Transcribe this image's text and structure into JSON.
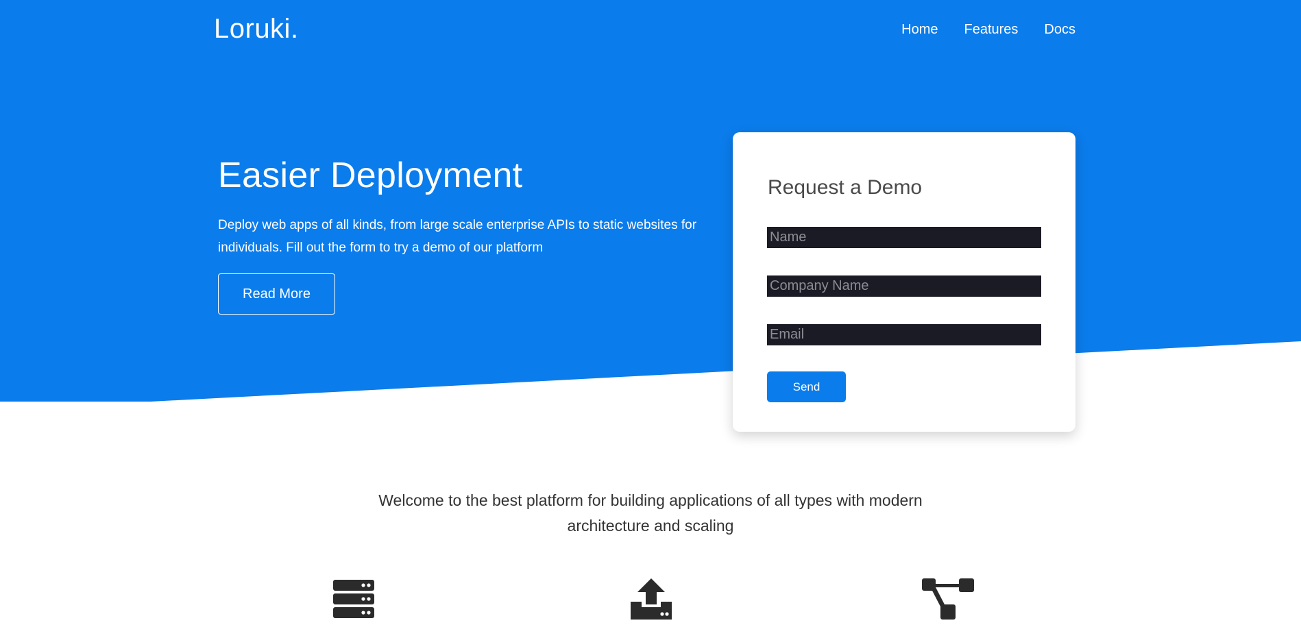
{
  "brand": {
    "logo": "Loruki.",
    "primary_color": "#0b7ceb",
    "input_bg_color": "#1b1b25",
    "text_dark_color": "#333333"
  },
  "nav": {
    "items": [
      {
        "label": "Home"
      },
      {
        "label": "Features"
      },
      {
        "label": "Docs"
      }
    ]
  },
  "hero": {
    "title": "Easier Deployment",
    "text": "Deploy web apps of all kinds, from large scale enterprise APIs to static websites for individuals. Fill out the form to try a demo of our platform",
    "button_label": "Read More"
  },
  "demo_form": {
    "title": "Request a Demo",
    "name_placeholder": "Name",
    "company_placeholder": "Company Name",
    "email_placeholder": "Email",
    "send_label": "Send"
  },
  "welcome": {
    "text": "Welcome to the best platform for building applications of all types with modern architecture and scaling"
  },
  "features": {
    "icons": [
      "server-icon",
      "upload-icon",
      "sitemap-icon"
    ]
  }
}
